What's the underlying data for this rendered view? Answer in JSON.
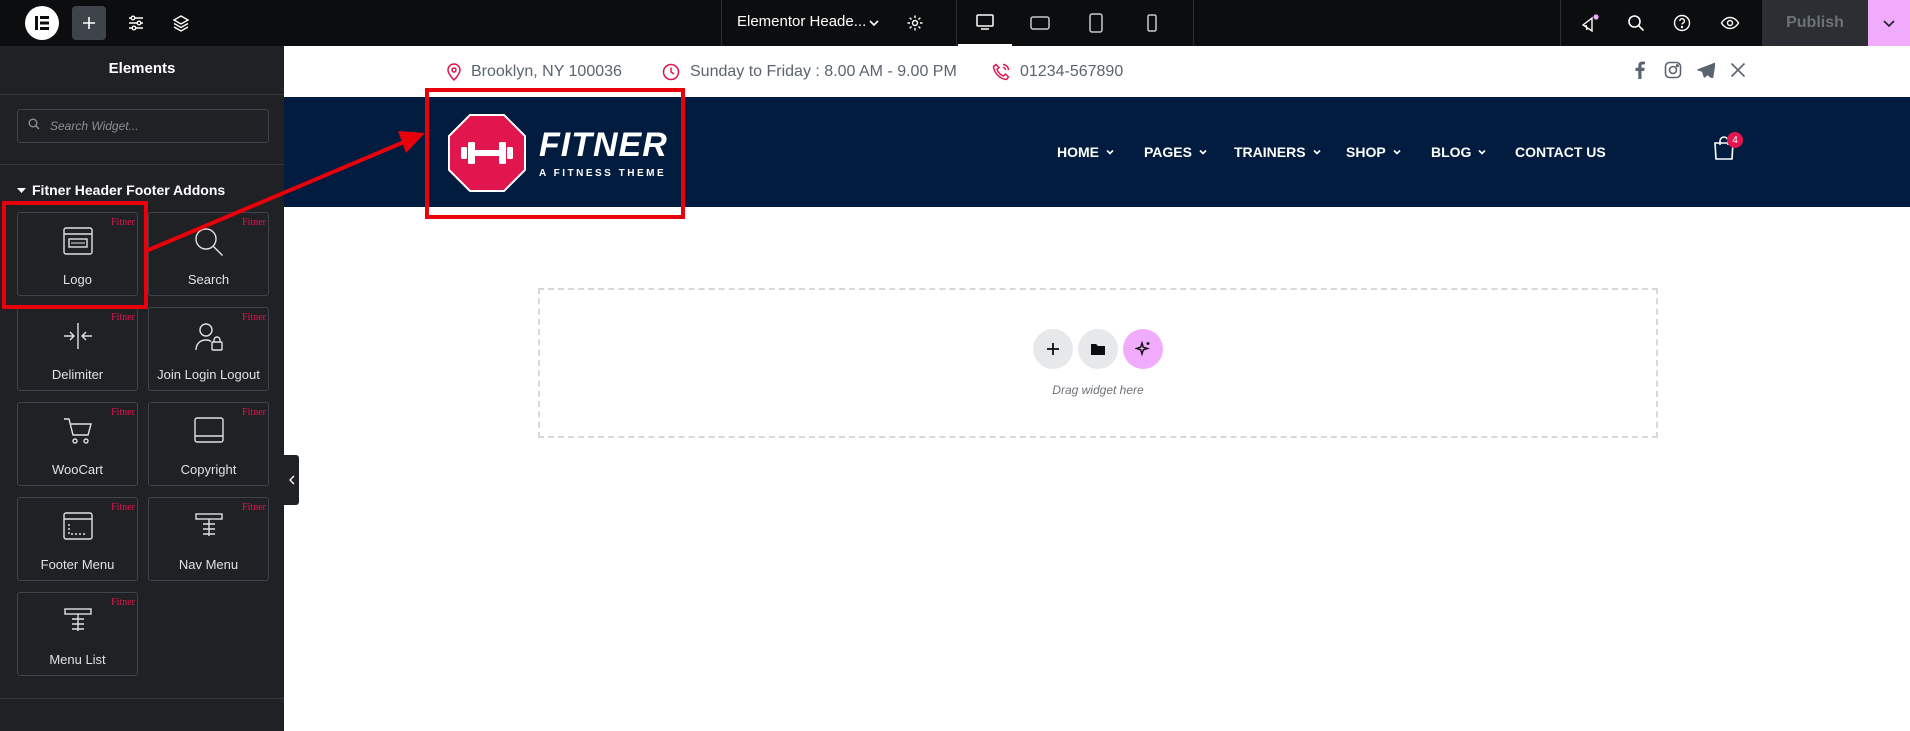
{
  "topbar": {
    "document_title": "Elementor Heade...",
    "publish_label": "Publish"
  },
  "sidebar": {
    "title": "Elements",
    "search_placeholder": "Search Widget...",
    "category": "Fitner Header Footer Addons",
    "widgets": [
      {
        "label": "Logo",
        "badge": "Fitner",
        "icon": "logo-widget-icon"
      },
      {
        "label": "Search",
        "badge": "Fitner",
        "icon": "search-icon"
      },
      {
        "label": "Delimiter",
        "badge": "Fitner",
        "icon": "delimiter-icon"
      },
      {
        "label": "Join Login Logout",
        "badge": "Fitner",
        "icon": "user-lock-icon"
      },
      {
        "label": "WooCart",
        "badge": "Fitner",
        "icon": "cart-icon"
      },
      {
        "label": "Copyright",
        "badge": "Fitner",
        "icon": "copyright-icon"
      },
      {
        "label": "Footer Menu",
        "badge": "Fitner",
        "icon": "footer-menu-icon"
      },
      {
        "label": "Nav Menu",
        "badge": "Fitner",
        "icon": "nav-menu-icon"
      },
      {
        "label": "Menu List",
        "badge": "Fitner",
        "icon": "menu-list-icon"
      }
    ]
  },
  "site": {
    "info": {
      "location": "Brooklyn, NY 100036",
      "hours": "Sunday to Friday : 8.00 AM - 9.00 PM",
      "phone": "01234-567890"
    },
    "logo": {
      "name": "FITNER",
      "tagline": "A FITNESS THEME"
    },
    "nav": [
      "HOME",
      "PAGES",
      "TRAINERS",
      "SHOP",
      "BLOG",
      "CONTACT US"
    ],
    "cart_count": "4",
    "social_icons": [
      "facebook-icon",
      "instagram-icon",
      "telegram-icon",
      "x-icon"
    ]
  },
  "dropzone": {
    "hint": "Drag widget here"
  },
  "colors": {
    "accent": "#e2164e",
    "navy": "#011c3f",
    "annotation": "#e8000b",
    "ai": "#f0abfc"
  }
}
